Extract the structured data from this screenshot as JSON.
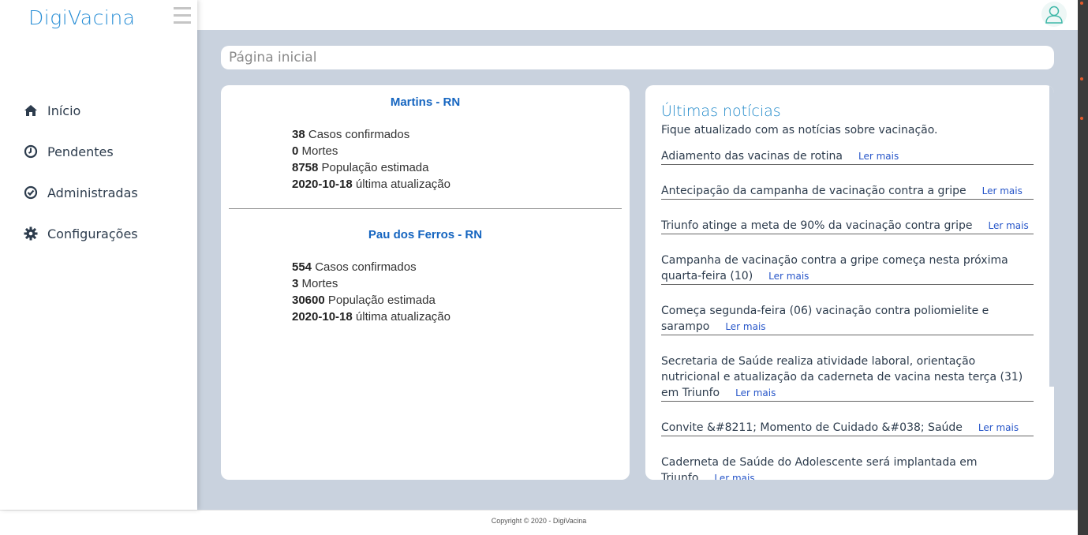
{
  "app": {
    "logo": "DigiVacina"
  },
  "sidebar": {
    "items": [
      {
        "label": "Início",
        "icon": "home-icon"
      },
      {
        "label": "Pendentes",
        "icon": "clock-icon"
      },
      {
        "label": "Administradas",
        "icon": "check-circle-icon"
      },
      {
        "label": "Configurações",
        "icon": "gear-icon"
      }
    ]
  },
  "breadcrumb": {
    "title": "Página inicial"
  },
  "cities": [
    {
      "name": "Martins - RN",
      "cases": "38",
      "cases_label": " Casos confirmados",
      "deaths": "0",
      "deaths_label": " Mortes",
      "population": "8758",
      "population_label": " População estimada",
      "updated": "2020-10-18",
      "updated_label": " última atualização"
    },
    {
      "name": "Pau dos Ferros - RN",
      "cases": "554",
      "cases_label": " Casos confirmados",
      "deaths": "3",
      "deaths_label": " Mortes",
      "population": "30600",
      "population_label": " População estimada",
      "updated": "2020-10-18",
      "updated_label": " última atualização"
    }
  ],
  "news": {
    "title": "Últimas notícias",
    "subtitle": "Fique atualizado com as notícias sobre vacinação.",
    "more_label": "Ler mais",
    "items": [
      "Adiamento das vacinas de rotina",
      "Antecipação da campanha de vacinação contra a gripe",
      "Triunfo atinge a meta de 90% da vacinação contra gripe",
      "Campanha de vacinação contra a gripe começa nesta próxima quarta-feira (10)",
      "Começa segunda-feira (06) vacinação contra poliomielite e sarampo",
      "Secretaria de Saúde realiza atividade laboral, orientação nutricional e atualização da caderneta de vacina nesta terça (31) em Triunfo",
      "Convite &#8211; Momento de Cuidado &#038; Saúde",
      "Caderneta de Saúde do Adolescente será implantada em Triunfo"
    ]
  },
  "footer": {
    "text": "Copyright © 2020 - DigiVacina"
  }
}
